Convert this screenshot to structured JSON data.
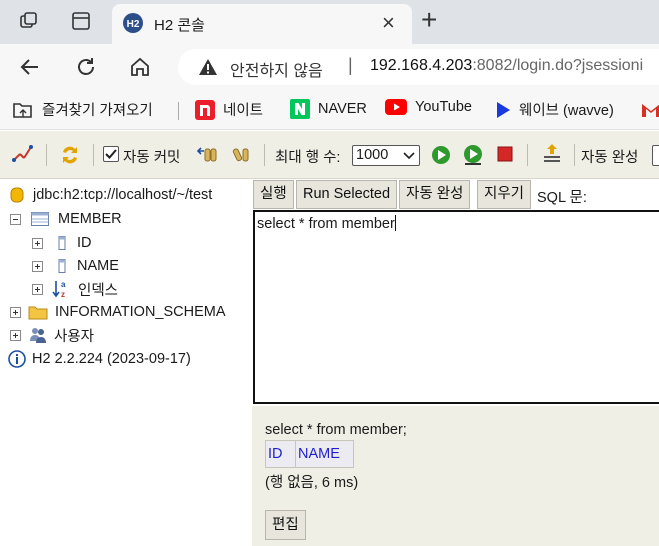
{
  "browser": {
    "tab": {
      "title": "H2 콘솔",
      "close": "×",
      "new_tab": "+"
    },
    "address": {
      "security_text": "안전하지 않음",
      "host": "192.168.4.203",
      "rest": ":8082/login.do?jsessioni"
    },
    "bookmarks": [
      {
        "label": "즐겨찾기 가져오기",
        "icon": "folder-import-icon"
      },
      {
        "label": "네이트",
        "icon": "nate-icon"
      },
      {
        "label": "NAVER",
        "icon": "naver-icon"
      },
      {
        "label": "YouTube",
        "icon": "youtube-icon"
      },
      {
        "label": "웨이브 (wavve)",
        "icon": "wavve-icon"
      }
    ]
  },
  "toolbar": {
    "auto_commit_label": "자동 커밋",
    "auto_commit_checked": true,
    "max_rows_label": "최대 행 수:",
    "max_rows_value": "1000",
    "auto_complete_label": "자동 완성"
  },
  "tree": {
    "connection": "jdbc:h2:tcp://localhost/~/test",
    "table": "MEMBER",
    "columns": [
      "ID",
      "NAME"
    ],
    "index_label": "인덱스",
    "schema": "INFORMATION_SCHEMA",
    "users": "사용자",
    "version": "H2 2.2.224 (2023-09-17)"
  },
  "query": {
    "buttons": {
      "run": "실행",
      "run_selected": "Run Selected",
      "auto_complete": "자동 완성",
      "clear": "지우기"
    },
    "sql_label": "SQL 문:",
    "sql_text": "select * from member"
  },
  "result": {
    "statement": "select * from member;",
    "headers": [
      "ID",
      "NAME"
    ],
    "status": "(행 없음, 6 ms)",
    "edit_button": "편집"
  },
  "colors": {
    "toolbar_bg": "#f0efe6",
    "header_link": "#1f1fcf",
    "tab_bar": "#dfe3e8"
  }
}
